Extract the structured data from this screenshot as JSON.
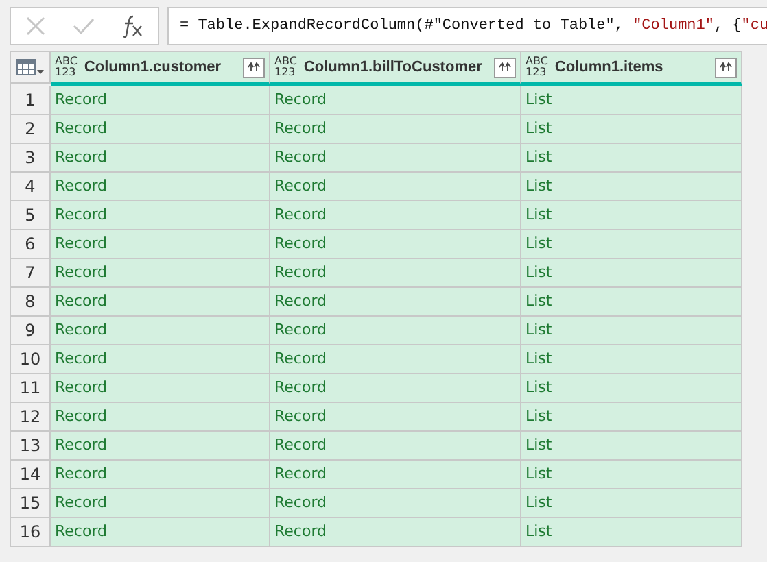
{
  "formula_bar": {
    "buttons": [
      {
        "kind": "cancel",
        "disabled": true
      },
      {
        "kind": "confirm",
        "disabled": true
      },
      {
        "kind": "fx",
        "disabled": false
      }
    ],
    "formula": [
      {
        "kind": "plain",
        "text": "= Table.ExpandRecordColumn(#\"Converted to Table\", "
      },
      {
        "kind": "string",
        "text": "\"Column1\""
      },
      {
        "kind": "plain",
        "text": ", {"
      },
      {
        "kind": "string",
        "text": "\"cu"
      }
    ]
  },
  "table": {
    "columns": [
      {
        "type_label": "ABC",
        "type_label_2": "123",
        "name": "Column1.customer"
      },
      {
        "type_label": "ABC",
        "type_label_2": "123",
        "name": "Column1.billToCustomer"
      },
      {
        "type_label": "ABC",
        "type_label_2": "123",
        "name": "Column1.items"
      }
    ],
    "rows": [
      {
        "number": "1",
        "cells": [
          "Record",
          "Record",
          "List"
        ]
      },
      {
        "number": "2",
        "cells": [
          "Record",
          "Record",
          "List"
        ]
      },
      {
        "number": "3",
        "cells": [
          "Record",
          "Record",
          "List"
        ]
      },
      {
        "number": "4",
        "cells": [
          "Record",
          "Record",
          "List"
        ]
      },
      {
        "number": "5",
        "cells": [
          "Record",
          "Record",
          "List"
        ]
      },
      {
        "number": "6",
        "cells": [
          "Record",
          "Record",
          "List"
        ]
      },
      {
        "number": "7",
        "cells": [
          "Record",
          "Record",
          "List"
        ]
      },
      {
        "number": "8",
        "cells": [
          "Record",
          "Record",
          "List"
        ]
      },
      {
        "number": "9",
        "cells": [
          "Record",
          "Record",
          "List"
        ]
      },
      {
        "number": "10",
        "cells": [
          "Record",
          "Record",
          "List"
        ]
      },
      {
        "number": "11",
        "cells": [
          "Record",
          "Record",
          "List"
        ]
      },
      {
        "number": "12",
        "cells": [
          "Record",
          "Record",
          "List"
        ]
      },
      {
        "number": "13",
        "cells": [
          "Record",
          "Record",
          "List"
        ]
      },
      {
        "number": "14",
        "cells": [
          "Record",
          "Record",
          "List"
        ]
      },
      {
        "number": "15",
        "cells": [
          "Record",
          "Record",
          "List"
        ]
      },
      {
        "number": "16",
        "cells": [
          "Record",
          "Record",
          "List"
        ]
      }
    ]
  }
}
